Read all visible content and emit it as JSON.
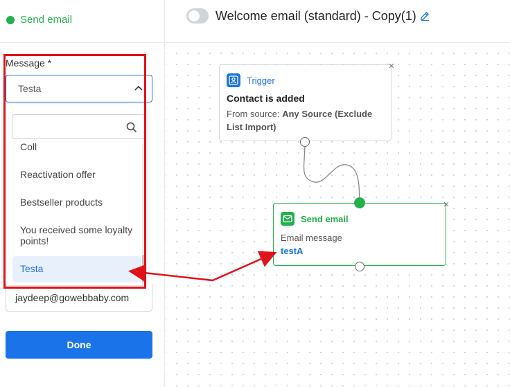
{
  "left_panel": {
    "title": "Send email",
    "message_label": "Message *",
    "selected_value": "Testa",
    "search_placeholder": "",
    "options": [
      "Coll",
      "Reactivation offer",
      "Bestseller products",
      "You received some loyalty points!",
      "Testa"
    ],
    "selected_index": 4,
    "email_value": "jaydeep@gowebbaby.com",
    "done_label": "Done"
  },
  "header": {
    "workflow_title": "Welcome email (standard) - Copy(1)",
    "toggle_on": false
  },
  "trigger_card": {
    "tag": "Trigger",
    "title": "Contact is added",
    "source_prefix": "From source: ",
    "source_value": "Any Source (Exclude List Import)",
    "close": "×"
  },
  "send_card": {
    "tag": "Send email",
    "label": "Email message",
    "value": "testA",
    "close": "×"
  },
  "icons": [
    "dot-icon",
    "chevron-up-icon",
    "search-icon",
    "pencil-icon",
    "contact-icon",
    "envelope-icon",
    "close-icon"
  ],
  "colors": {
    "accent": "#1a73e8",
    "success": "#22b04b",
    "annotation": "#e0121b"
  }
}
